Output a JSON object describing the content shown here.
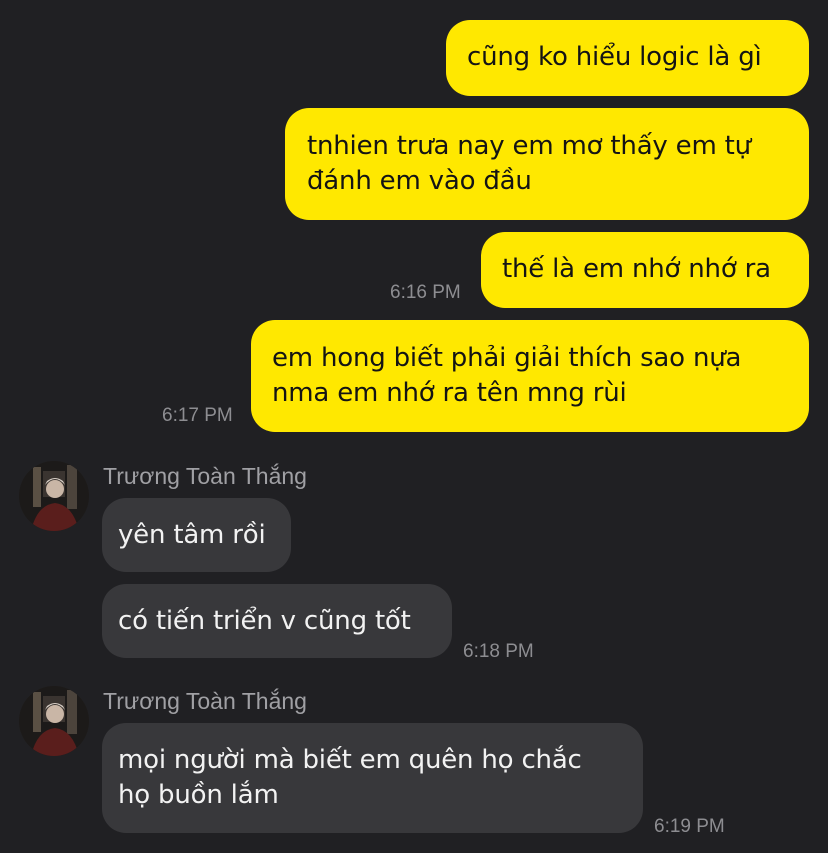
{
  "messages": {
    "m1": {
      "text": "cũng ko hiểu logic là gì"
    },
    "m2": {
      "text": "tnhien trưa nay em mơ thấy em tự\nđánh em vào đầu"
    },
    "m3": {
      "text": "thế là em nhớ nhớ ra",
      "time": "6:16 PM"
    },
    "m4": {
      "text": "em hong biết phải giải thích sao nựa\nnma em nhớ ra tên mng rùi",
      "time": "6:17 PM"
    },
    "g1": {
      "sender": "Trương Toàn Thắng",
      "m5": {
        "text": "yên tâm rồi"
      },
      "m6": {
        "text": "có tiến triển v cũng tốt",
        "time": "6:18 PM"
      }
    },
    "g2": {
      "sender": "Trương Toàn Thắng",
      "m7": {
        "text": "mọi người mà biết em quên họ chắc\nhọ buồn lắm",
        "time": "6:19 PM"
      }
    }
  },
  "colors": {
    "background": "#202023",
    "outgoing_bubble": "#ffe800",
    "incoming_bubble": "#38383b"
  }
}
